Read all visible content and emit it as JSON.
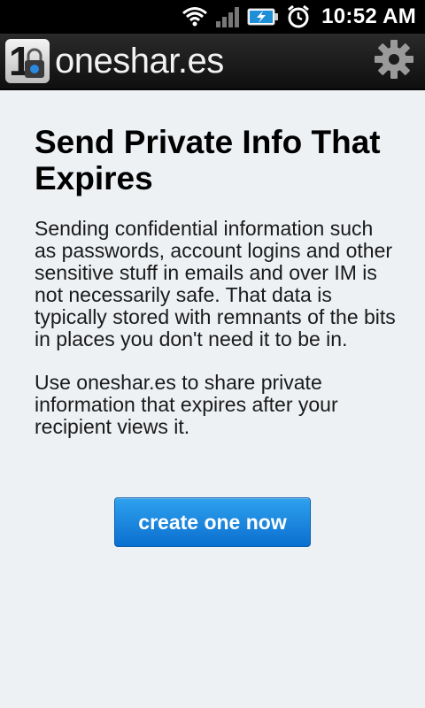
{
  "status_bar": {
    "time": "10:52 AM",
    "icons": [
      "wifi-icon",
      "signal-icon",
      "battery-charging-icon",
      "alarm-icon"
    ]
  },
  "app_bar": {
    "logo_digit": "1",
    "title": "oneshar.es",
    "settings_icon": "gear-icon"
  },
  "main": {
    "headline": "Send Private Info That Expires",
    "paragraph1": "Sending confidential information such as passwords, account logins and other sensitive stuff in emails and over IM is not necessarily safe. That data is typically stored with remnants of the bits in places you don't need it to be in.",
    "paragraph2": "Use oneshar.es to share private information that expires after your recipient views it.",
    "cta_label": "create one now"
  },
  "colors": {
    "cta_top": "#2ea1ee",
    "cta_bottom": "#0b6fcf",
    "background": "#eef1f4",
    "appbar": "#1b1b1b"
  }
}
